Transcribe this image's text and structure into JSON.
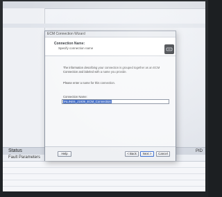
{
  "background_app": {
    "status_label": "Status",
    "fault_label": "Fault Parameters",
    "pid_label": "PID"
  },
  "dialog": {
    "window_title": "ECM Connection Wizard",
    "header": {
      "title": "Connection Name:",
      "subtitle": "Specify connection name"
    },
    "body": {
      "info_text": "The information describing your connection is grouped together as an ECM Connection and labeled with a name you provide.",
      "prompt_text": "Please enter a name for this connection.",
      "field_label": "Connection Name:",
      "field_value": "INLINE6_J1939_ECM_Connection"
    },
    "buttons": {
      "help": "Help",
      "back": "< Back",
      "next": "Next >",
      "cancel": "Cancel"
    }
  }
}
